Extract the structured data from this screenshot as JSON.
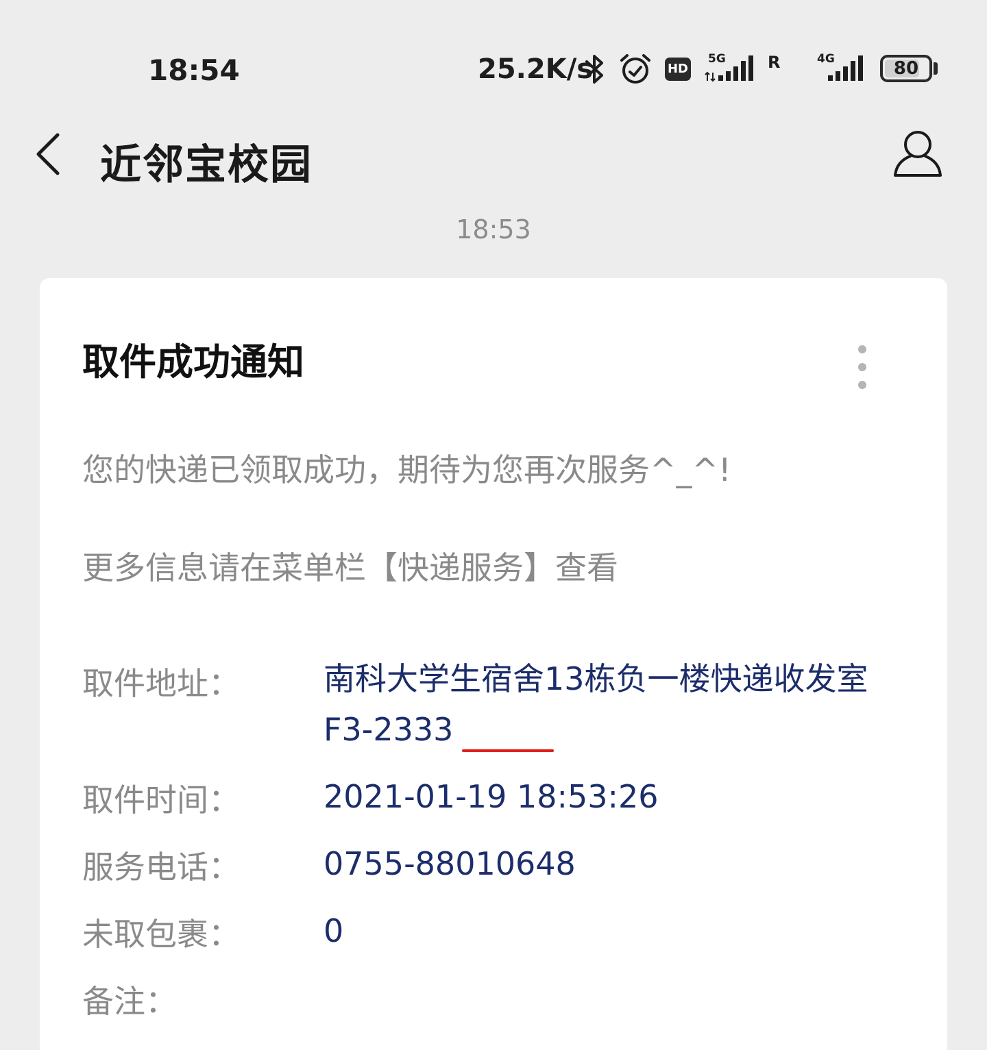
{
  "status_bar": {
    "time": "18:54",
    "net_speed": "25.2K/s",
    "icons": [
      "bluetooth-icon",
      "alarm-icon",
      "hd-icon",
      "signal-5g-icon",
      "roaming-icon",
      "signal-4g-icon",
      "battery-icon"
    ],
    "hd_label": "HD",
    "network_5g": "5G",
    "roaming": "R",
    "network_4g": "4G",
    "battery_level": "80",
    "battery_fraction": 0.8
  },
  "header": {
    "title": "近邻宝校园",
    "back_icon": "chevron-left-icon",
    "profile_icon": "user-icon"
  },
  "message_time": "18:53",
  "card": {
    "title": "取件成功通知",
    "more_icon": "more-vertical-icon",
    "line1": "您的快递已领取成功，期待为您再次服务^_^!",
    "line2": "更多信息请在菜单栏【快递服务】查看",
    "fields": [
      {
        "label": "取件地址：",
        "value": "南科大学生宿舍13栋负一楼快递收发室F3-2333"
      },
      {
        "label": "取件时间：",
        "value": "2021-01-19 18:53:26"
      },
      {
        "label": "服务电话：",
        "value": "0755-88010648"
      },
      {
        "label": "未取包裹：",
        "value": "0"
      },
      {
        "label": "备注：",
        "value": ""
      }
    ]
  },
  "colors": {
    "background": "#ededed",
    "card": "#ffffff",
    "label_gray": "#8a8a8a",
    "value_navy": "#1c2d6b",
    "underline_red": "#e02020"
  }
}
